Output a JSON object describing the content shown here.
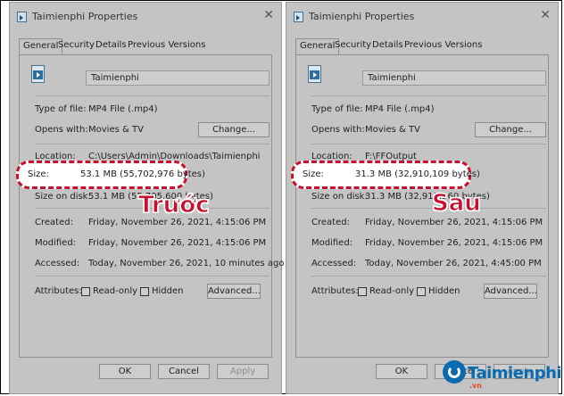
{
  "left": {
    "title": "Taimienphi Properties",
    "tabs": [
      "General",
      "Security",
      "Details",
      "Previous Versions"
    ],
    "filename": "Taimienphi",
    "type_label": "Type of file:",
    "type_value": "MP4 File (.mp4)",
    "opens_label": "Opens with:",
    "opens_value": "Movies & TV",
    "change_button": "Change...",
    "location_label": "Location:",
    "location_value": "C:\\Users\\Admin\\Downloads\\Taimienphi",
    "size_label": "Size:",
    "size_value": "53.1 MB (55,702,976 bytes)",
    "disk_label": "Size on disk:",
    "disk_value": "53.1 MB (55,705,600 bytes)",
    "created_label": "Created:",
    "created_value": "Friday, November 26, 2021, 4:15:06 PM",
    "modified_label": "Modified:",
    "modified_value": "Friday, November 26, 2021, 4:15:06 PM",
    "accessed_label": "Accessed:",
    "accessed_value": "Today, November 26, 2021, 10 minutes ago",
    "attributes_label": "Attributes:",
    "readonly_label": "Read-only",
    "hidden_label": "Hidden",
    "advanced_button": "Advanced...",
    "ok_button": "OK",
    "cancel_button": "Cancel",
    "apply_button": "Apply",
    "annotation": "Trước"
  },
  "right": {
    "title": "Taimienphi Properties",
    "tabs": [
      "General",
      "Security",
      "Details",
      "Previous Versions"
    ],
    "filename": "Taimienphi",
    "type_label": "Type of file:",
    "type_value": "MP4 File (.mp4)",
    "opens_label": "Opens with:",
    "opens_value": "Movies & TV",
    "change_button": "Change...",
    "location_label": "Location:",
    "location_value": "F:\\FFOutput",
    "size_label": "Size:",
    "size_value": "31.3 MB (32,910,109 bytes)",
    "disk_label": "Size on disk:",
    "disk_value": "31.3 MB (32,911,360 bytes)",
    "created_label": "Created:",
    "created_value": "Friday, November 26, 2021, 4:15:06 PM",
    "modified_label": "Modified:",
    "modified_value": "Friday, November 26, 2021, 4:15:06 PM",
    "accessed_label": "Accessed:",
    "accessed_value": "Today, November 26, 2021, 4:45:00 PM",
    "attributes_label": "Attributes:",
    "readonly_label": "Read-only",
    "hidden_label": "Hidden",
    "advanced_button": "Advanced...",
    "ok_button": "OK",
    "cancel_button": "Cancel",
    "apply_button": "Apply",
    "annotation": "Sau"
  },
  "brand": {
    "logo_text": "Taimienphi",
    "logo_sub": ".vn",
    "accent": "#c8102e",
    "logo_color": "#0a6bb0"
  }
}
